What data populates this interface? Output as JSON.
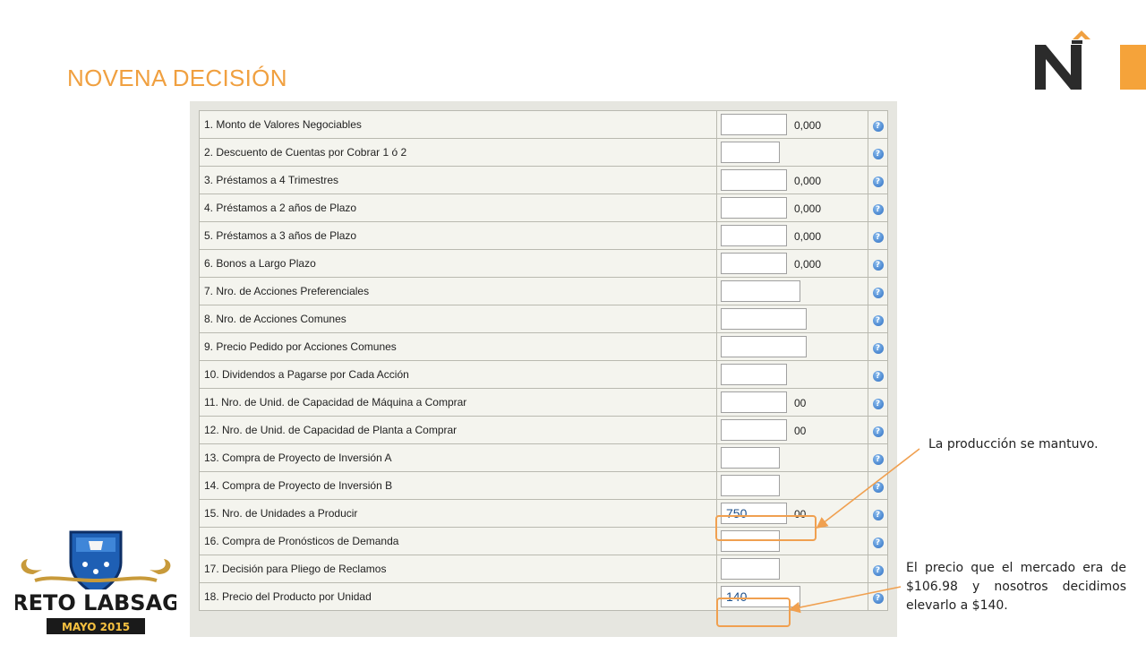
{
  "slide": {
    "title": "NOVENA DECISIÓN"
  },
  "badge": {
    "line1": "RETO LABSAG",
    "line2": "MAYO 2015"
  },
  "form": {
    "help_glyph": "?",
    "rows": [
      {
        "label": "1. Monto de Valores Negociables",
        "value": "",
        "suffix": "0,000"
      },
      {
        "label": "2. Descuento de Cuentas por Cobrar 1 ó 2",
        "value": "",
        "suffix": ""
      },
      {
        "label": "3. Préstamos a 4 Trimestres",
        "value": "",
        "suffix": "0,000"
      },
      {
        "label": "4. Préstamos a 2 años de Plazo",
        "value": "",
        "suffix": "0,000"
      },
      {
        "label": "5. Préstamos a 3 años de Plazo",
        "value": "",
        "suffix": "0,000"
      },
      {
        "label": "6. Bonos a Largo Plazo",
        "value": "",
        "suffix": "0,000"
      },
      {
        "label": "7. Nro. de Acciones Preferenciales",
        "value": "",
        "suffix": ""
      },
      {
        "label": "8. Nro. de Acciones Comunes",
        "value": "",
        "suffix": ""
      },
      {
        "label": "9. Precio Pedido por Acciones Comunes",
        "value": "",
        "suffix": ""
      },
      {
        "label": "10. Dividendos a Pagarse por Cada Acción",
        "value": "",
        "suffix": ""
      },
      {
        "label": "11. Nro. de Unid. de Capacidad de Máquina a Comprar",
        "value": "",
        "suffix": "00"
      },
      {
        "label": "12. Nro. de Unid. de Capacidad de Planta a Comprar",
        "value": "",
        "suffix": "00"
      },
      {
        "label": "13. Compra de Proyecto de Inversión A",
        "value": "",
        "suffix": ""
      },
      {
        "label": "14. Compra de Proyecto de Inversión B",
        "value": "",
        "suffix": ""
      },
      {
        "label": "15. Nro. de Unidades a Producir",
        "value": "750",
        "suffix": "00"
      },
      {
        "label": "16. Compra de Pronósticos de Demanda",
        "value": "",
        "suffix": ""
      },
      {
        "label": "17. Decisión para Pliego de Reclamos",
        "value": "",
        "suffix": ""
      },
      {
        "label": "18. Precio del Producto por Unidad",
        "value": "140",
        "suffix": ""
      }
    ]
  },
  "annotations": {
    "production": "La producción se mantuvo.",
    "price": "El precio que el mercado era de $106.98 y nosotros decidimos elevarlo a $140."
  },
  "colors": {
    "accent": "#f0a040",
    "highlight": "#f0a050",
    "badge_blue": "#1e5fb4",
    "badge_gold": "#c89a3a"
  }
}
